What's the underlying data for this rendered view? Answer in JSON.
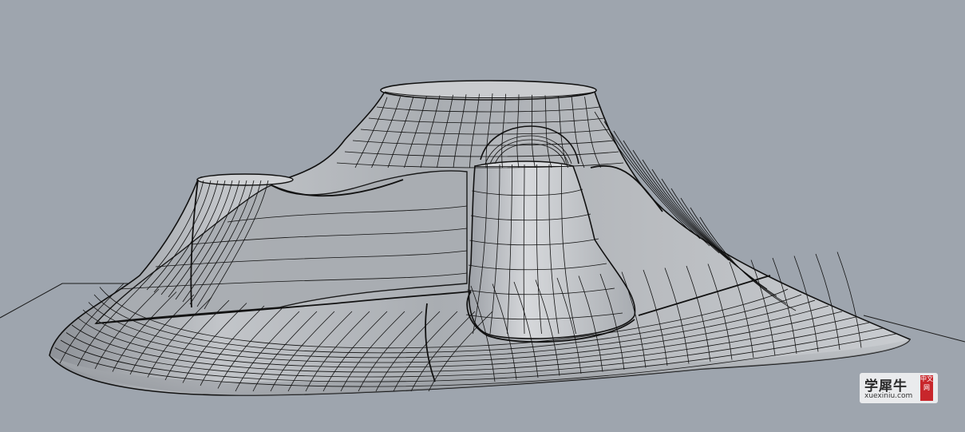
{
  "viewport": {
    "background": "#9ea5ae",
    "surface_color": "#b8bbbf",
    "wire_color": "#111111",
    "object": "nurbs-surface-isocurves"
  },
  "watermark": {
    "text_cn": "学犀牛",
    "url": "xuexiniu.com",
    "badge": "中文网",
    "badge_color": "#c8262b"
  }
}
